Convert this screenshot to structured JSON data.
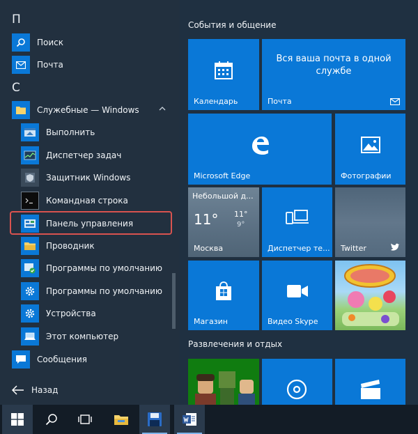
{
  "left_menu": {
    "sections": [
      {
        "letter": "П"
      },
      {
        "letter": "С"
      }
    ],
    "apps": [
      {
        "label": "Поиск",
        "icon": "search-icon"
      },
      {
        "label": "Почта",
        "icon": "mail-icon"
      },
      {
        "label": "Служебные — Windows",
        "icon": "folder-icon"
      },
      {
        "label": "Выполнить",
        "icon": "run-icon"
      },
      {
        "label": "Диспетчер задач",
        "icon": "task-manager-icon"
      },
      {
        "label": "Защитник Windows",
        "icon": "windows-defender-icon"
      },
      {
        "label": "Командная строка",
        "icon": "command-prompt-icon"
      },
      {
        "label": "Панель управления",
        "icon": "control-panel-icon"
      },
      {
        "label": "Проводник",
        "icon": "file-explorer-icon"
      },
      {
        "label": "Программы по умолчанию",
        "icon": "default-programs-icon"
      },
      {
        "label": "Программы по умолчанию",
        "icon": "gear-icon"
      },
      {
        "label": "Устройства",
        "icon": "gear-icon"
      },
      {
        "label": "Этот компьютер",
        "icon": "computer-icon"
      },
      {
        "label": "Сообщения",
        "icon": "messaging-icon"
      }
    ],
    "back_label": "Назад"
  },
  "groups": {
    "events_title": "События и общение",
    "entertainment_title": "Развлечения и отдых"
  },
  "tiles": {
    "calendar": "Календарь",
    "mail_text": "Вся ваша почта в одной службе",
    "mail": "Почта",
    "edge": "Microsoft Edge",
    "photos": "Фотографии",
    "weather_title": "Небольшой д...",
    "weather_temp": "11°",
    "weather_high": "11°",
    "weather_low": "9°",
    "weather_city": "Москва",
    "phone_companion": "Диспетчер те...",
    "twitter": "Twitter",
    "store": "Магазин",
    "skype_video": "Видео Skype"
  },
  "colors": {
    "tile_blue": "#0a78d7",
    "start_bg": "#22303f",
    "highlight": "#d9534f"
  }
}
